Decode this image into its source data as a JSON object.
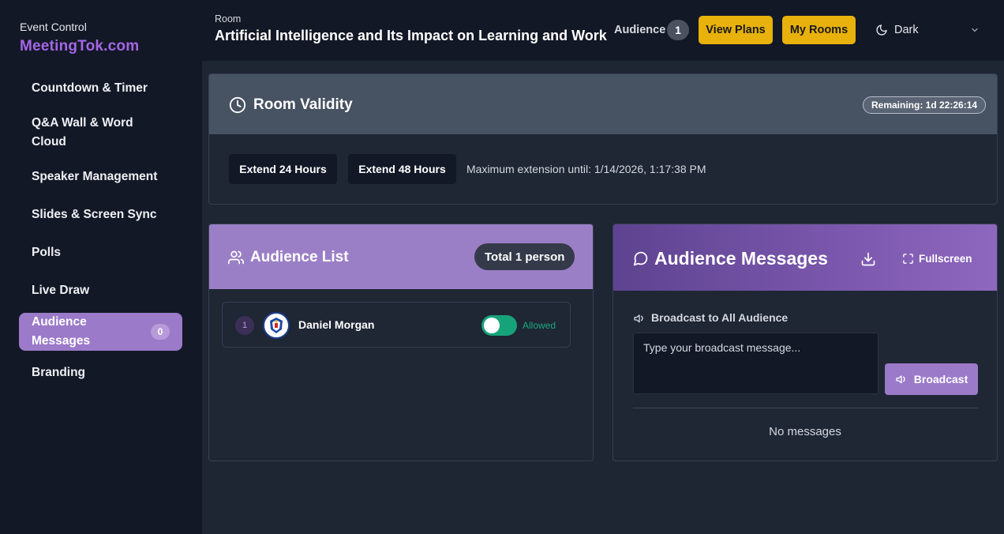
{
  "brand": {
    "subtitle": "Event Control",
    "name": "MeetingTok.com"
  },
  "sidebar": {
    "items": [
      {
        "label": "Countdown & Timer"
      },
      {
        "label": "Q&A Wall & Word Cloud"
      },
      {
        "label": "Speaker Management"
      },
      {
        "label": "Slides & Screen Sync"
      },
      {
        "label": "Polls"
      },
      {
        "label": "Live Draw"
      },
      {
        "label": "Audience Messages",
        "badge": "0",
        "active": true
      },
      {
        "label": "Branding"
      }
    ]
  },
  "header": {
    "room_label": "Room",
    "room_title": "Artificial Intelligence and Its Impact on Learning and Work",
    "audience_label": "Audience",
    "audience_count": "1",
    "view_plans": "View Plans",
    "my_rooms": "My Rooms",
    "theme": "Dark"
  },
  "validity": {
    "title": "Room Validity",
    "remaining": "Remaining: 1d 22:26:14",
    "extend24": "Extend 24 Hours",
    "extend48": "Extend 48 Hours",
    "max_extension": "Maximum extension until: 1/14/2026, 1:17:38 PM"
  },
  "audience_list": {
    "title": "Audience List",
    "total": "Total 1 person",
    "people": [
      {
        "index": "1",
        "name": "Daniel Morgan",
        "status": "Allowed",
        "allowed": true
      }
    ]
  },
  "messages": {
    "title": "Audience Messages",
    "fullscreen": "Fullscreen",
    "broadcast_label": "Broadcast to All Audience",
    "broadcast_placeholder": "Type your broadcast message...",
    "broadcast_button": "Broadcast",
    "empty": "No messages"
  },
  "colors": {
    "accent": "#9b7ac9",
    "brand": "#a366e6",
    "yellow": "#e8b10b",
    "success": "#16a37a"
  }
}
